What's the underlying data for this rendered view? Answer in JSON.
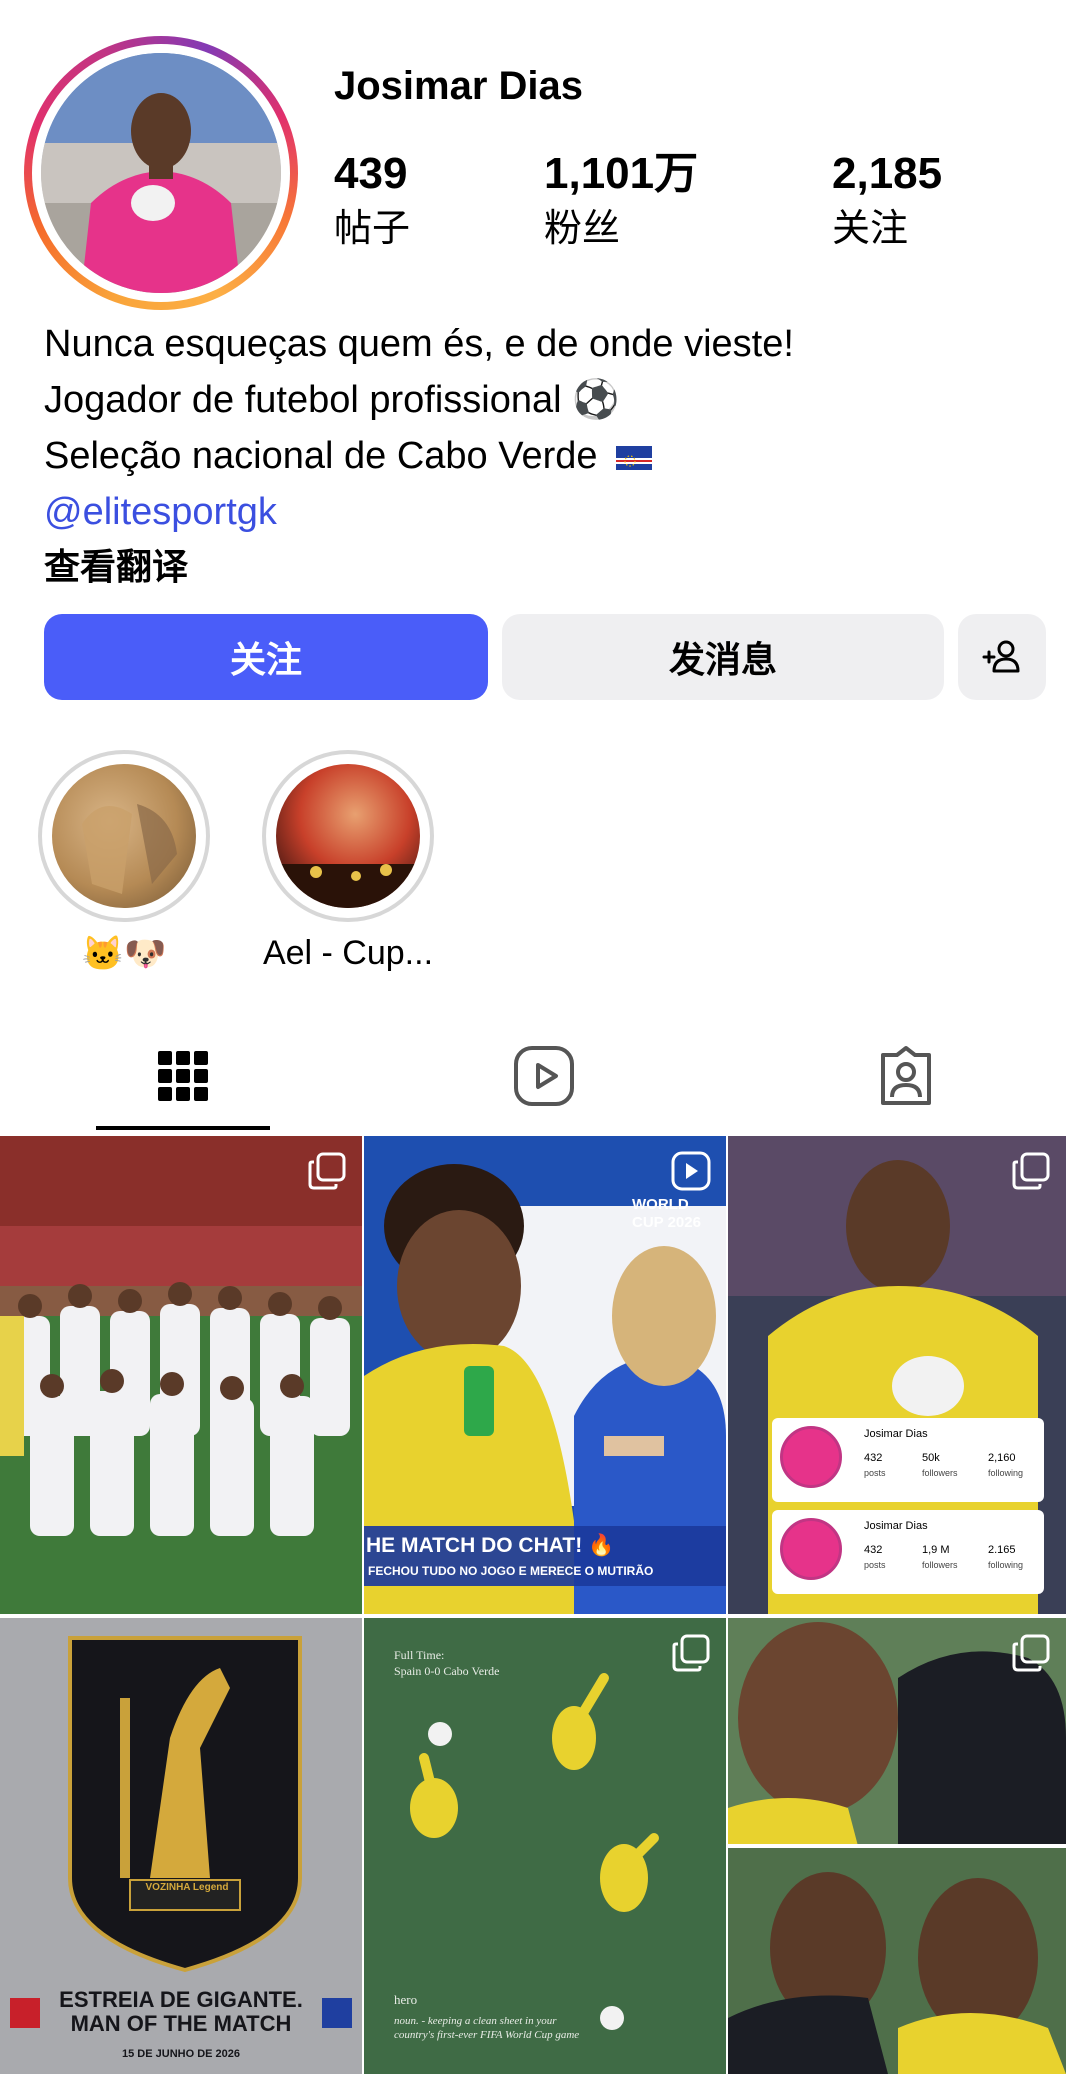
{
  "profile": {
    "name": "Josimar Dias",
    "stats": [
      {
        "value": "439",
        "label": "帖子"
      },
      {
        "value": "1,101万",
        "label": "粉丝"
      },
      {
        "value": "2,185",
        "label": "关注"
      }
    ]
  },
  "bio": {
    "line1": "Nunca esqueças quem és, e de onde vieste!",
    "line2": "Jogador de futebol profissional ⚽",
    "line3": "Seleção nacional de Cabo Verde",
    "mention": "@elitesportgk",
    "translate": "查看翻译"
  },
  "actions": {
    "follow": "关注",
    "message": "发消息"
  },
  "highlights": [
    {
      "label": "🐱🐶"
    },
    {
      "label": "Ael - Cup..."
    }
  ],
  "tabs": [
    {
      "icon": "grid-icon",
      "active": true
    },
    {
      "icon": "reels-icon",
      "active": false
    },
    {
      "icon": "tagged-icon",
      "active": false
    }
  ],
  "posts": {
    "post2": {
      "overlay": "HE MATCH DO CHAT! 🔥",
      "overlay2": "FECHOU TUDO NO JOGO E MERECE O MUTIRÃO",
      "badge": "WORLD CUP 2026"
    },
    "post3": {
      "cards": [
        {
          "name": "Josimar Dias",
          "posts": "432",
          "posts_l": "posts",
          "followers": "50k",
          "followers_l": "followers",
          "following": "2,160",
          "following_l": "following"
        },
        {
          "name": "Josimar Dias",
          "posts": "432",
          "posts_l": "posts",
          "followers": "1,9 M",
          "followers_l": "followers",
          "following": "2.165",
          "following_l": "following"
        }
      ]
    },
    "post4": {
      "line1": "ESTREIA DE GIGANTE.",
      "line2": "MAN OF THE MATCH",
      "date": "15 DE JUNHO DE 2026",
      "trophy": "VOZINHA Legend"
    },
    "post5": {
      "title": "Full Time:",
      "score": "Spain 0-0 Cabo Verde",
      "hero": "hero",
      "def": "noun. - keeping a clean sheet in your country's first-ever FIFA World Cup game"
    }
  },
  "colors": {
    "accent": "#4a5df9",
    "mention": "#3b4fe0",
    "button_bg": "#efeff1"
  }
}
